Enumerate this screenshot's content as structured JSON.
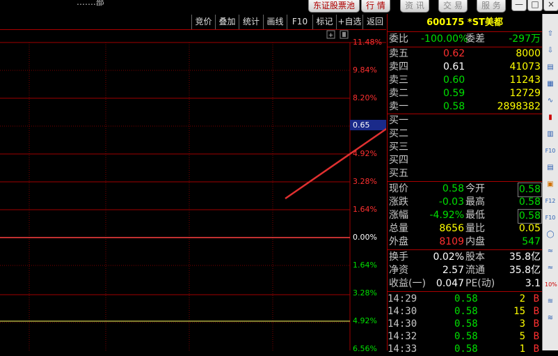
{
  "top": {
    "title_garbled": "…….部",
    "btn_stock_pool": "东证股票池",
    "btn_quote": "行 情",
    "btn_info": "资 讯",
    "btn_trade": "交 易",
    "btn_service": "服 务"
  },
  "toolbar": {
    "items": [
      "竞价",
      "叠加",
      "统计",
      "画线",
      "F10",
      "标记",
      "+自选",
      "返回"
    ]
  },
  "chart": {
    "pct_labels": [
      "11.48%",
      "9.84%",
      "8.20%",
      "4.92%",
      "3.28%",
      "1.64%",
      "0.00%",
      "1.64%",
      "3.28%",
      "4.92%",
      "6.56%"
    ],
    "cursor_price": "0.65"
  },
  "quote": {
    "stock_code": "600175",
    "stock_name": "*ST美都",
    "weibi_label": "委比",
    "weibi_value": "-100.00%",
    "weicha_label": "委差",
    "weicha_value": "-297万",
    "asks": [
      {
        "label": "卖五",
        "price": "0.62",
        "vol": "8000"
      },
      {
        "label": "卖四",
        "price": "0.61",
        "vol": "41073"
      },
      {
        "label": "卖三",
        "price": "0.60",
        "vol": "11243"
      },
      {
        "label": "卖二",
        "price": "0.59",
        "vol": "12729"
      },
      {
        "label": "卖一",
        "price": "0.58",
        "vol": "2898382"
      }
    ],
    "bids": [
      {
        "label": "买一"
      },
      {
        "label": "买二"
      },
      {
        "label": "买三"
      },
      {
        "label": "买四"
      },
      {
        "label": "买五"
      }
    ],
    "stats": [
      {
        "l1": "现价",
        "v1": "0.58",
        "l2": "今开",
        "v2": "0.58"
      },
      {
        "l1": "涨跌",
        "v1": "-0.03",
        "l2": "最高",
        "v2": "0.58"
      },
      {
        "l1": "涨幅",
        "v1": "-4.92%",
        "l2": "最低",
        "v2": "0.58"
      },
      {
        "l1": "总量",
        "v1": "8656",
        "l2": "量比",
        "v2": "0.05"
      },
      {
        "l1": "外盘",
        "v1": "8109",
        "l2": "内盘",
        "v2": "547"
      }
    ],
    "fund": [
      {
        "l1": "换手",
        "v1": "0.02%",
        "l2": "股本",
        "v2": "35.8亿"
      },
      {
        "l1": "净资",
        "v1": "2.57",
        "l2": "流通",
        "v2": "35.8亿"
      },
      {
        "l1": "收益(一)",
        "v1": "0.047",
        "l2": "PE(动)",
        "v2": "3.1"
      }
    ],
    "ticks": [
      {
        "time": "14:29",
        "price": "0.58",
        "vol": "2",
        "side": "B"
      },
      {
        "time": "14:30",
        "price": "0.58",
        "vol": "15",
        "side": "B"
      },
      {
        "time": "14:30",
        "price": "0.58",
        "vol": "3",
        "side": "B"
      },
      {
        "time": "14:32",
        "price": "0.58",
        "vol": "5",
        "side": "B"
      },
      {
        "time": "14:33",
        "price": "0.58",
        "vol": "1",
        "side": "B"
      }
    ]
  },
  "sidebar": {
    "icons": [
      "arrow-up-icon",
      "arrow-down-icon",
      "list-icon",
      "table-icon",
      "line-chart-icon",
      "candle-chart-icon",
      "grid-icon",
      "f10-icon",
      "list2-icon",
      "note-icon",
      "f12-icon",
      "f10-alt-icon",
      "refresh-icon",
      "wave-icon",
      "wave2-icon",
      "percent-icon",
      "wave3-icon",
      "wave4-icon"
    ],
    "icon_labels": [
      "⇧",
      "⇩",
      "▤",
      "▦",
      "∿",
      "▮",
      "▥",
      "F10",
      "▤",
      "▣",
      "F12",
      "F10",
      "◯",
      "≈",
      "≈",
      "10%",
      "≋",
      "≋"
    ]
  },
  "colors": {
    "up": "#ff3030",
    "down": "#00e000",
    "frame": "#a00000",
    "highlight": "#1a2a8a",
    "annotation_arrow": "#e03030"
  }
}
